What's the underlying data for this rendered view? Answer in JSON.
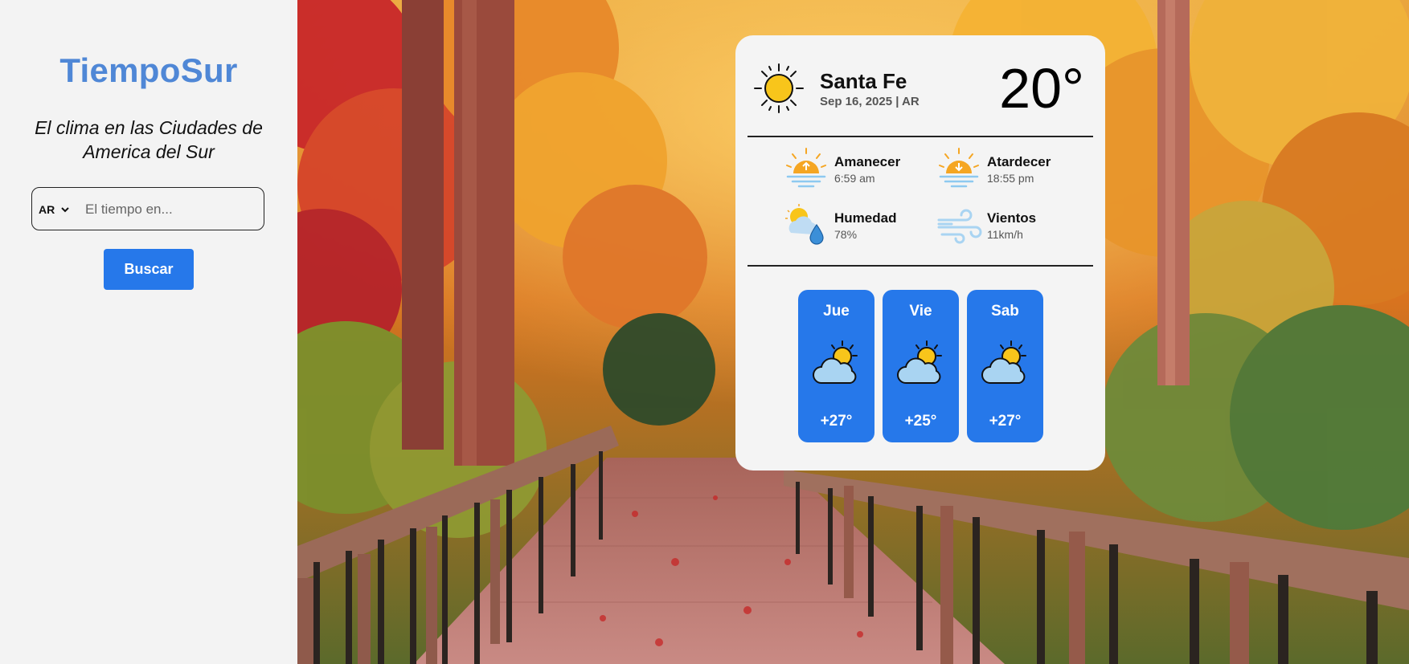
{
  "sidebar": {
    "brand": "TiempoSur",
    "tagline": "El clima en las Ciudades de America del Sur",
    "country_select": {
      "selected": "AR"
    },
    "search": {
      "placeholder": "El tiempo en...",
      "value": ""
    },
    "search_button": "Buscar"
  },
  "current": {
    "city": "Santa Fe",
    "date": "Sep 16, 2025 | AR",
    "temperature": "20°",
    "icon": "sun-icon"
  },
  "stats": [
    {
      "label": "Amanecer",
      "value": "6:59 am",
      "icon": "sunrise-icon"
    },
    {
      "label": "Atardecer",
      "value": "18:55 pm",
      "icon": "sunset-icon"
    },
    {
      "label": "Humedad",
      "value": "78%",
      "icon": "humidity-icon"
    },
    {
      "label": "Vientos",
      "value": "11km/h",
      "icon": "wind-icon"
    }
  ],
  "forecast": [
    {
      "day": "Jue",
      "temp": "+27°",
      "icon": "partly-cloudy-icon"
    },
    {
      "day": "Vie",
      "temp": "+25°",
      "icon": "partly-cloudy-icon"
    },
    {
      "day": "Sab",
      "temp": "+27°",
      "icon": "partly-cloudy-icon"
    }
  ],
  "colors": {
    "brand": "#4f87d6",
    "accent": "#2678ea",
    "card_bg": "#f4f4f4",
    "sidebar_bg": "#f3f3f3",
    "sun": "#f8c51b"
  }
}
